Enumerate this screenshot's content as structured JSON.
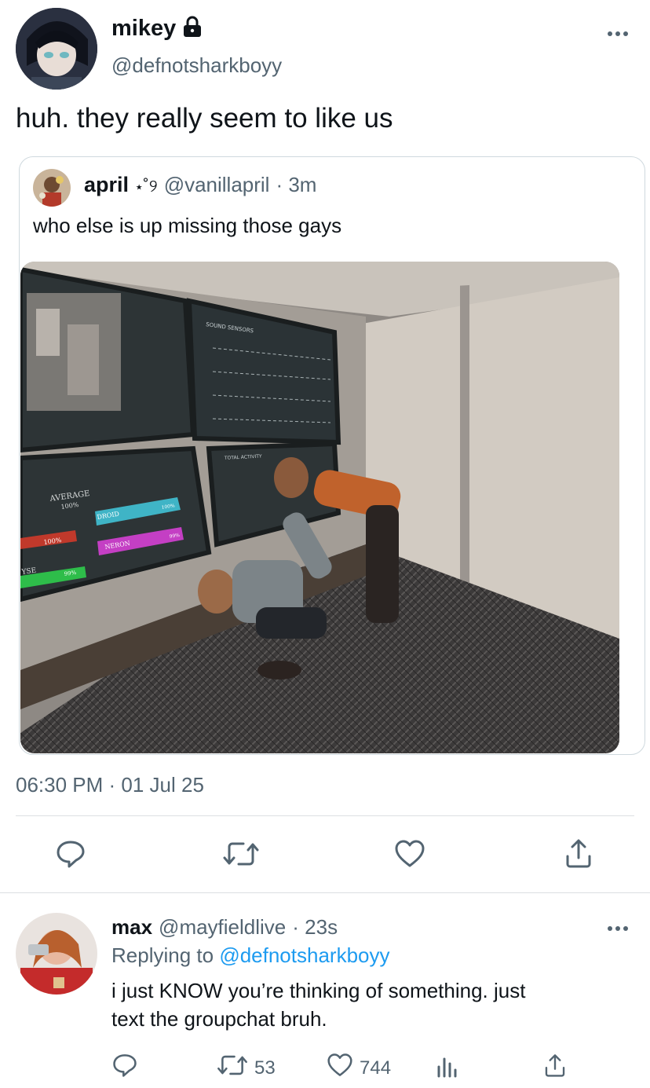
{
  "tweet": {
    "author_name": "mikey",
    "author_handle": "@defnotsharkboyy",
    "text": "huh. they really seem to like us",
    "timestamp": "06:30 PM · 01 Jul 25",
    "quoted": {
      "author_name": "april",
      "author_deco": "⋆˚୨",
      "author_handle": "@vanillapril",
      "time": "· 3m",
      "text": "who else is up missing those gays",
      "image": {
        "panel_labels": {
          "sound_sensors": "SOUND SENSORS",
          "average": "AVERAGE",
          "average_value": "100%",
          "bar1": "100%",
          "bar2": "99%",
          "ysE": "YSE",
          "droid": "DROID",
          "droid_value": "100%",
          "neron": "NERON",
          "neron_value": "99%",
          "total_activity": "TOTAL ACTIVITY"
        }
      }
    }
  },
  "reply": {
    "author_name": "max",
    "author_handle": "@mayfieldlive",
    "time": "· 23s",
    "replying_prefix": "Replying to",
    "replying_handle": "@defnotsharkboyy",
    "text_line1": "i just KNOW you’re thinking of something. just",
    "text_line2": "text the groupchat bruh.",
    "retweets": "53",
    "likes": "744"
  },
  "icons": {
    "lock": "lock-icon",
    "more": "more-icon",
    "reply": "reply-icon",
    "retweet": "retweet-icon",
    "like": "heart-icon",
    "share": "share-icon",
    "analytics": "analytics-icon"
  },
  "colors": {
    "text": "#0f1419",
    "secondary": "#536471",
    "link": "#1d9bf0",
    "divider": "#dcdfe2"
  }
}
